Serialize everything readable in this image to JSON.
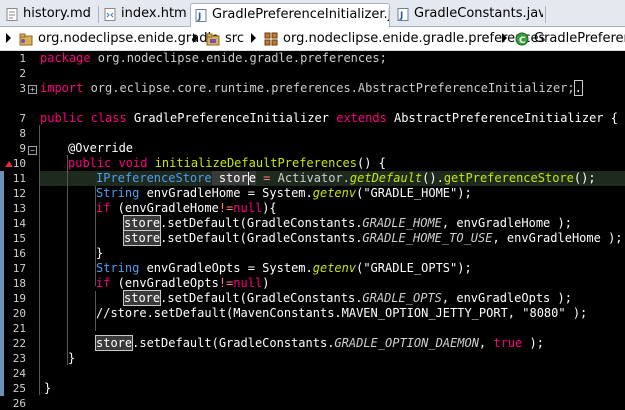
{
  "tabs": [
    {
      "label": "history.md",
      "icon": "markdown-file-icon",
      "active": false
    },
    {
      "label": "index.html",
      "icon": "html-file-icon",
      "active": false
    },
    {
      "label": "GradlePreferenceInitializer.java",
      "icon": "java-file-icon",
      "active": true
    },
    {
      "label": "GradleConstants.java",
      "icon": "java-file-icon",
      "active": false
    }
  ],
  "breadcrumb": [
    {
      "label": "org.nodeclipse.enide.gradle",
      "icon": "project-icon"
    },
    {
      "label": "src",
      "icon": "source-folder-icon"
    },
    {
      "label": "org.nodeclipse.enide.gradle.preferences",
      "icon": "package-icon"
    },
    {
      "label": "GradlePreference",
      "icon": "class-icon"
    }
  ],
  "editor": {
    "line_numbers": [
      "1",
      "2",
      "3",
      "7",
      "8",
      "9",
      "10",
      "11",
      "12",
      "13",
      "14",
      "15",
      "16",
      "17",
      "18",
      "19",
      "20",
      "21",
      "22",
      "23",
      "24",
      "25",
      "26"
    ],
    "code": {
      "l1_kw": "package",
      "l1_pkg": " org.nodeclipse.enide.gradle.preferences;",
      "l3_kw": "import",
      "l3_pkg": " org.eclipse.core.runtime.preferences.AbstractPreferenceInitializer;",
      "l3_tail": ".",
      "l7_a": "public class",
      "l7_b": " GradlePreferenceInitializer ",
      "l7_c": "extends",
      "l7_d": " AbstractPreferenceInitializer {",
      "l9": "@Override",
      "l10_a": "public void",
      "l10_b": " initializeDefaultPreferences",
      "l10_c": "() {",
      "l11_a": "IPreferenceStore",
      "l11_b": " stor",
      "l11_c": "e",
      "l11_d": " = ",
      "l11_e": "Activator.",
      "l11_f": "getDefault",
      "l11_g": "().",
      "l11_h": "getPreferenceStore",
      "l11_i": "();",
      "l12_a": "String",
      "l12_b": " envGradleHome = System.",
      "l12_c": "getenv",
      "l12_d": "(\"GRADLE_HOME\");",
      "l13_a": "if",
      "l13_b": " (envGradleHome",
      "l13_c": "!=",
      "l13_d": "null",
      "l13_e": "){",
      "l14_a": "store",
      "l14_b": ".setDefault(GradleConstants.",
      "l14_c": "GRADLE_HOME",
      "l14_d": ", envGradleHome );",
      "l15_a": "store",
      "l15_b": ".setDefault(GradleConstants.",
      "l15_c": "GRADLE_HOME_TO_USE",
      "l15_d": ", envGradleHome );",
      "l16": "}",
      "l17_a": "String",
      "l17_b": " envGradleOpts = System.",
      "l17_c": "getenv",
      "l17_d": "(\"GRADLE_OPTS\");",
      "l18_a": "if",
      "l18_b": " (envGradleOpts",
      "l18_c": "!=",
      "l18_d": "null",
      "l18_e": ")",
      "l19_a": "store",
      "l19_b": ".setDefault(GradleConstants.",
      "l19_c": "GRADLE_OPTS",
      "l19_d": ", envGradleOpts );",
      "l20": "//store.setDefault(MavenConstants.MAVEN_OPTION_JETTY_PORT, \"8080\" );",
      "l22_a": "store",
      "l22_b": ".setDefault(GradleConstants.",
      "l22_c": "GRADLE_OPTION_DAEMON",
      "l22_d": ", ",
      "l22_e": "true",
      "l22_f": " );",
      "l23": "}",
      "l25": "}"
    }
  }
}
